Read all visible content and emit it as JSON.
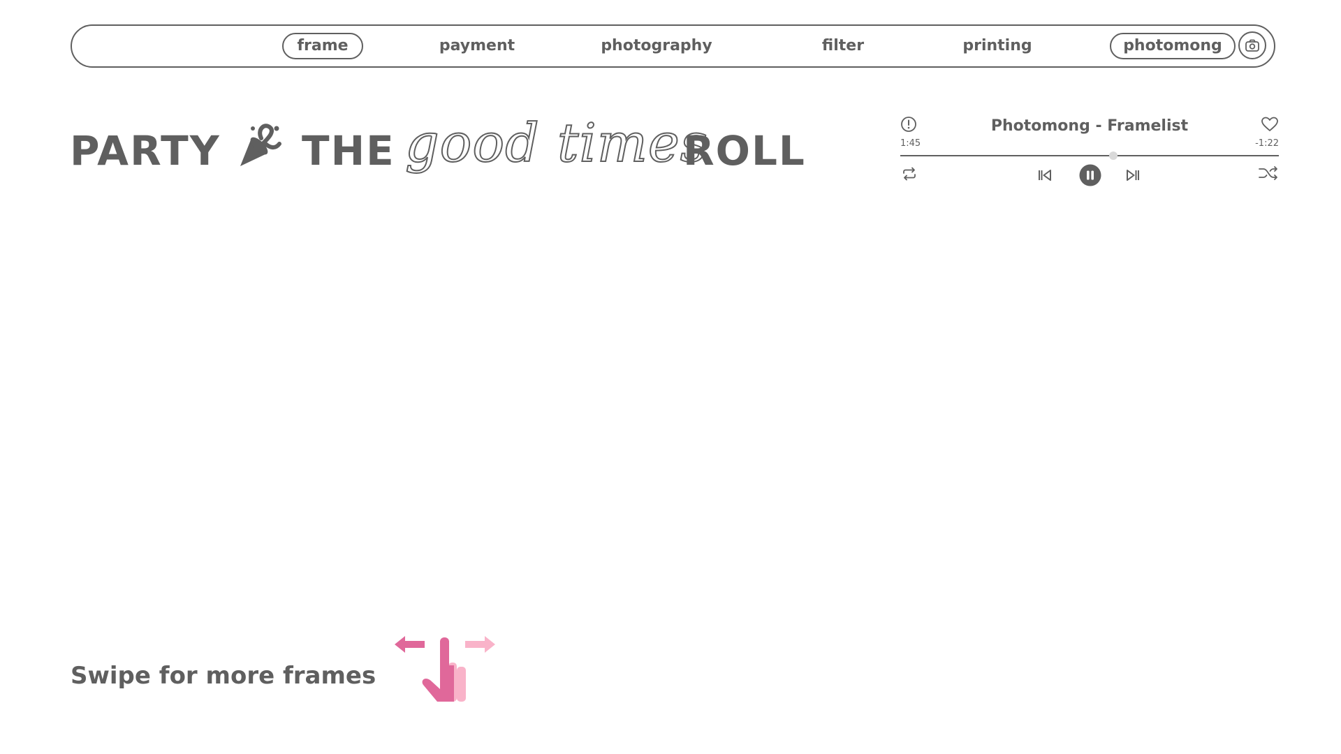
{
  "nav": {
    "items": [
      {
        "label": "frame",
        "active": true
      },
      {
        "label": "payment",
        "active": false
      },
      {
        "label": "photography",
        "active": false
      },
      {
        "label": "filter",
        "active": false
      },
      {
        "label": "printing",
        "active": false
      },
      {
        "label": "photomong",
        "active": true
      }
    ],
    "camera_icon": "camera-icon"
  },
  "headline": {
    "word1": "PARTY",
    "amp_icon": "party-popper-ampersand-icon",
    "word2": "THE",
    "script": "good times",
    "word3": "ROLL"
  },
  "player": {
    "title": "Photomong - Framelist",
    "elapsed": "1:45",
    "remaining": "-1:22",
    "progress": 0.5625,
    "icons": {
      "info": "info-icon",
      "favorite": "heart-icon",
      "repeat": "repeat-icon",
      "previous": "skip-previous-icon",
      "pause": "pause-icon",
      "next": "skip-next-icon",
      "shuffle": "shuffle-icon"
    }
  },
  "swipe": {
    "label": "Swipe for more frames",
    "icon": "swipe-hand-icon",
    "colors": {
      "primary": "#e0689a",
      "secondary": "#f9b3c9"
    }
  },
  "colors": {
    "text": "#5f5f5f",
    "background": "#ffffff",
    "thumb": "#d9d9d9"
  }
}
